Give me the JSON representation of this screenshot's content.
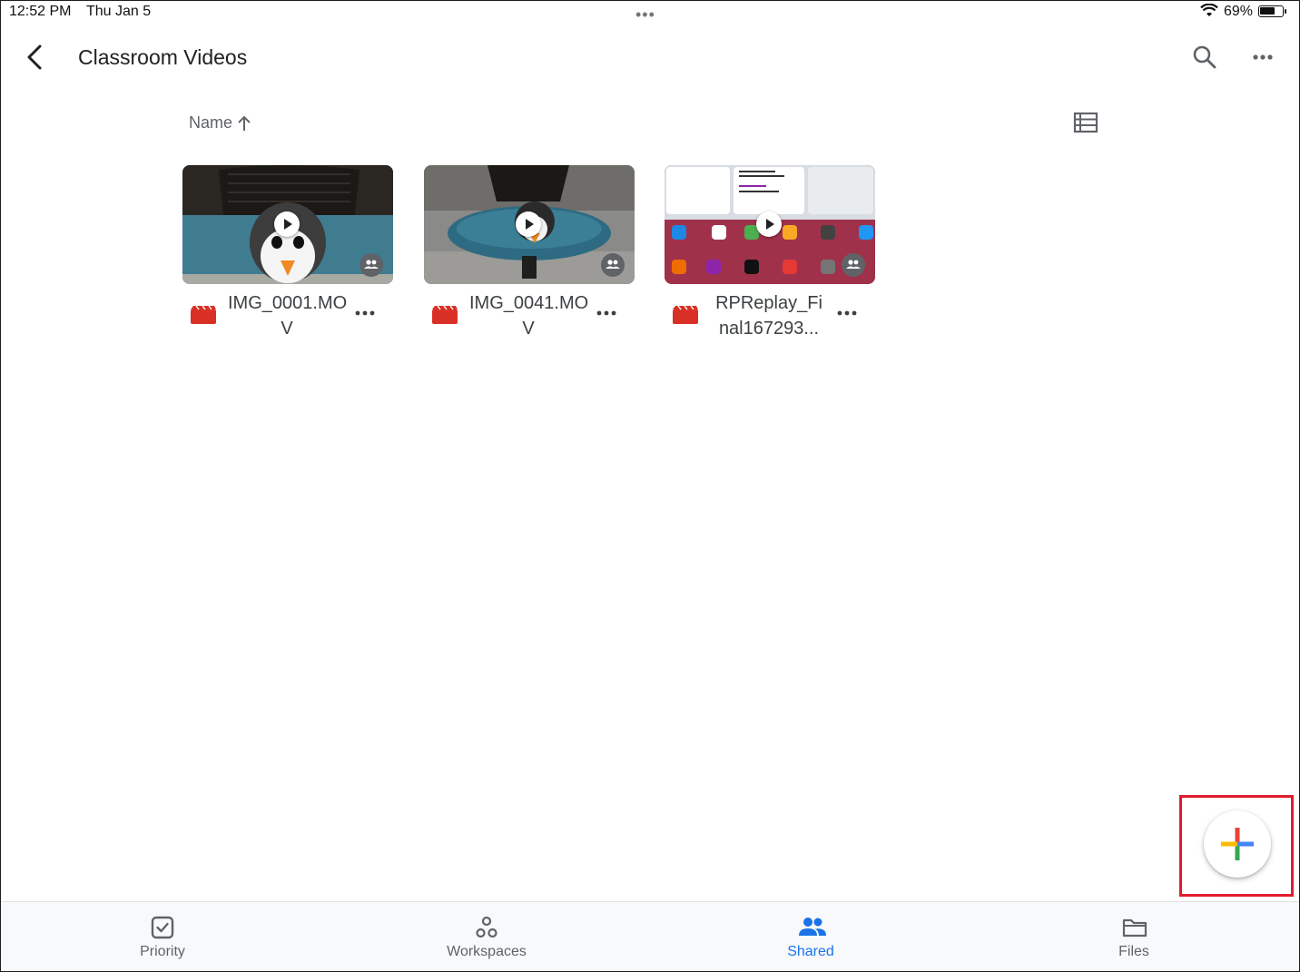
{
  "status_bar": {
    "time": "12:52 PM",
    "date": "Thu Jan 5",
    "battery": "69%"
  },
  "header": {
    "title": "Classroom Videos"
  },
  "sort": {
    "label": "Name"
  },
  "files": [
    {
      "name": "IMG_0001.MOV",
      "type": "video",
      "shared": true
    },
    {
      "name": "IMG_0041.MOV",
      "type": "video",
      "shared": true
    },
    {
      "name": "RPReplay_Final167293...",
      "type": "video",
      "shared": true
    }
  ],
  "bottom_nav": [
    {
      "label": "Priority",
      "icon": "priority-icon",
      "active": false
    },
    {
      "label": "Workspaces",
      "icon": "workspaces-icon",
      "active": false
    },
    {
      "label": "Shared",
      "icon": "shared-icon",
      "active": true
    },
    {
      "label": "Files",
      "icon": "folder-icon",
      "active": false
    }
  ],
  "colors": {
    "accent": "#1a73e8",
    "file_icon": "#d93025",
    "highlight": "#e01d2e"
  }
}
